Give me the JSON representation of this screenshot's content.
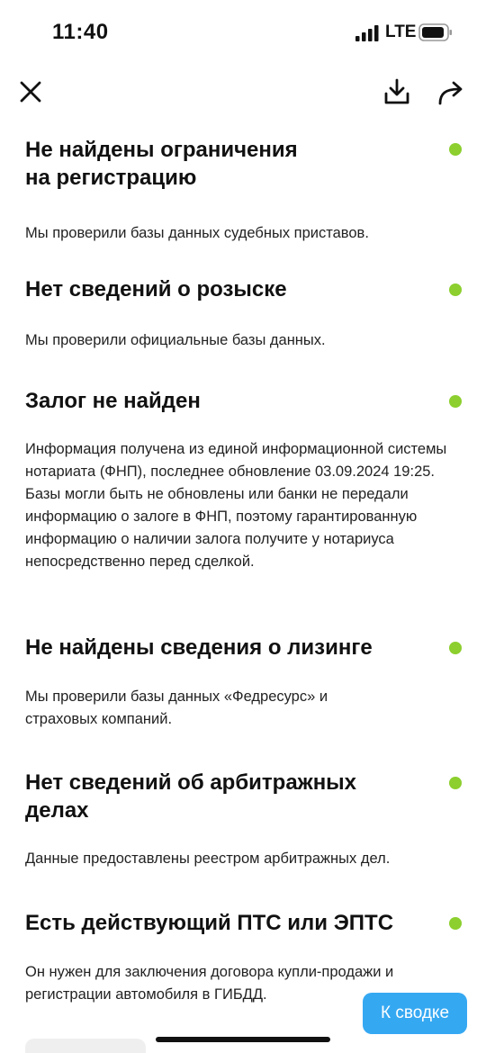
{
  "status_bar": {
    "time": "11:40",
    "network": "LTE",
    "icons": [
      "signal-icon",
      "battery-icon"
    ]
  },
  "toolbar": {
    "icons": [
      "close-icon",
      "download-icon",
      "share-icon"
    ]
  },
  "sections": [
    {
      "title": "Не найдены ограничения на регистрацию",
      "description": "Мы проверили базы данных судебных приставов.",
      "status_color": "#8ccf2e"
    },
    {
      "title": "Нет сведений о розыске",
      "description": "Мы проверили официальные базы данных.",
      "status_color": "#8ccf2e"
    },
    {
      "title": "Залог не найден",
      "description": "Информация получена из единой информационной системы нотариата (ФНП), последнее обновление 03.09.2024 19:25. Базы могли быть не обновлены или банки не передали информацию о залоге в ФНП, поэтому гарантированную информацию о наличии залога получите у нотариуса непосредственно перед сделкой.",
      "status_color": "#8ccf2e"
    },
    {
      "title": "Не найдены сведения о лизинге",
      "description": "Мы проверили базы данных «Федресурс» и страховых компаний.",
      "status_color": "#8ccf2e"
    },
    {
      "title": "Нет сведений об арбитражных делах",
      "description": "Данные предоставлены реестром арбитражных дел.",
      "status_color": "#8ccf2e"
    },
    {
      "title": "Есть действующий ПТС или ЭПТС",
      "description": "Он нужен для заключения договора купли-продажи и регистрации автомобиля в ГИБДД.",
      "status_color": "#8ccf2e"
    }
  ],
  "summary_button": {
    "label": "К сводке",
    "color": "#35a8f2"
  }
}
